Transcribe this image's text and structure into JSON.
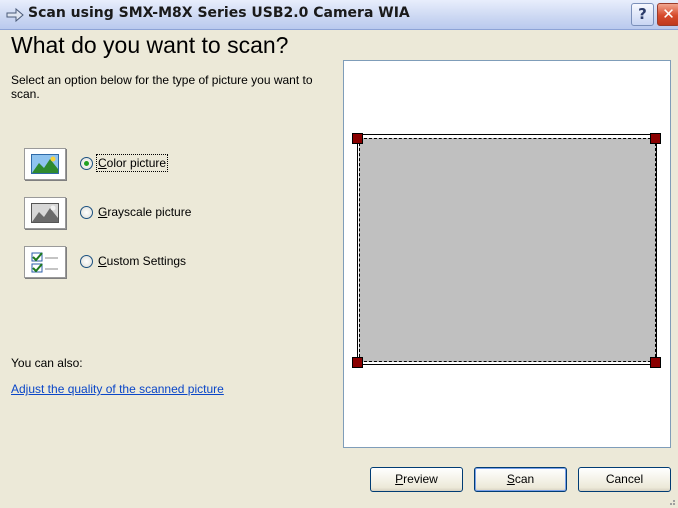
{
  "window": {
    "title": "Scan using SMX-M8X Series USB2.0 Camera WIA",
    "title_icon": "scanner-arrow-icon",
    "help_label": "?",
    "close_label": "✕"
  },
  "main": {
    "heading": "What do you want to scan?",
    "instruction": "Select an option below for the type of picture you want to scan.",
    "options": [
      {
        "icon": "color-picture-icon",
        "label_accel": "C",
        "label_rest": "olor picture",
        "selected": true
      },
      {
        "icon": "grayscale-picture-icon",
        "label_accel": "G",
        "label_rest": "rayscale picture",
        "selected": false
      },
      {
        "icon": "custom-settings-icon",
        "label_accel": "C",
        "label_rest": "ustom Settings",
        "selected": false
      }
    ],
    "also_text": "You can also:",
    "link_text": "Adjust the quality of the scanned picture"
  },
  "buttons": {
    "preview_accel": "P",
    "preview_rest": "review",
    "scan_accel": "S",
    "scan_rest": "can",
    "cancel": "Cancel"
  },
  "colors": {
    "link": "#0a46c8",
    "handle": "#8a0000",
    "selection_fill": "#c0c0c0"
  }
}
